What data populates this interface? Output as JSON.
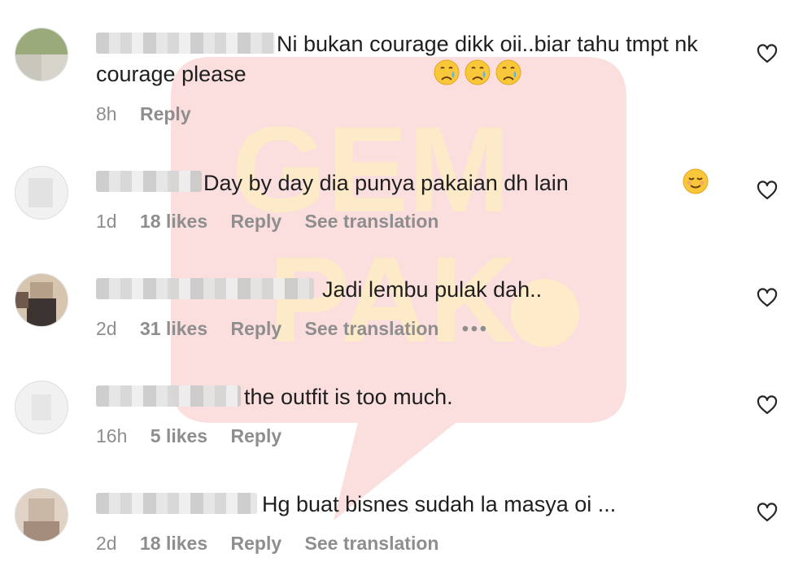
{
  "watermark": {
    "text_line1": "GEM",
    "text_line2": "PAK",
    "color": "#f4a6a6",
    "accent": "#fde9a7"
  },
  "comments": [
    {
      "avatar_colors": [
        "#9aaa7a",
        "#c9c7bb",
        "#d6d4cb",
        "#b0b89c"
      ],
      "text": "Ni bukan courage dikk oii..biar tahu tmpt nk courage please",
      "emojis": [
        "crying-face",
        "crying-face",
        "crying-face"
      ],
      "time": "8h",
      "likes": "",
      "reply": "Reply",
      "translation": "",
      "more": ""
    },
    {
      "avatar_colors": [
        "#e9e9e9",
        "#f3f3f3",
        "#e2e2e2",
        "#efefef"
      ],
      "text": "Day by day dia punya pakaian dh lain",
      "emojis": [
        "relieved-face"
      ],
      "time": "1d",
      "likes": "18 likes",
      "reply": "Reply",
      "translation": "See translation",
      "more": ""
    },
    {
      "avatar_colors": [
        "#6e5a4c",
        "#b7a08a",
        "#3b3431",
        "#d8c5b0"
      ],
      "text": "Jadi lembu pulak dah..",
      "emojis": [],
      "time": "2d",
      "likes": "31 likes",
      "reply": "Reply",
      "translation": "See translation",
      "more": "•••"
    },
    {
      "avatar_colors": [
        "#ececec",
        "#f5f5f5",
        "#e6e6e6",
        "#f0f0f0"
      ],
      "text": "the outfit is too much.",
      "emojis": [],
      "time": "16h",
      "likes": "5 likes",
      "reply": "Reply",
      "translation": "",
      "more": ""
    },
    {
      "avatar_colors": [
        "#c9b7a6",
        "#a58d7c",
        "#e0d2c4",
        "#8d7a6c"
      ],
      "text": "Hg buat bisnes sudah la masya oi ...",
      "emojis": [],
      "time": "2d",
      "likes": "18 likes",
      "reply": "Reply",
      "translation": "See translation",
      "more": ""
    }
  ]
}
